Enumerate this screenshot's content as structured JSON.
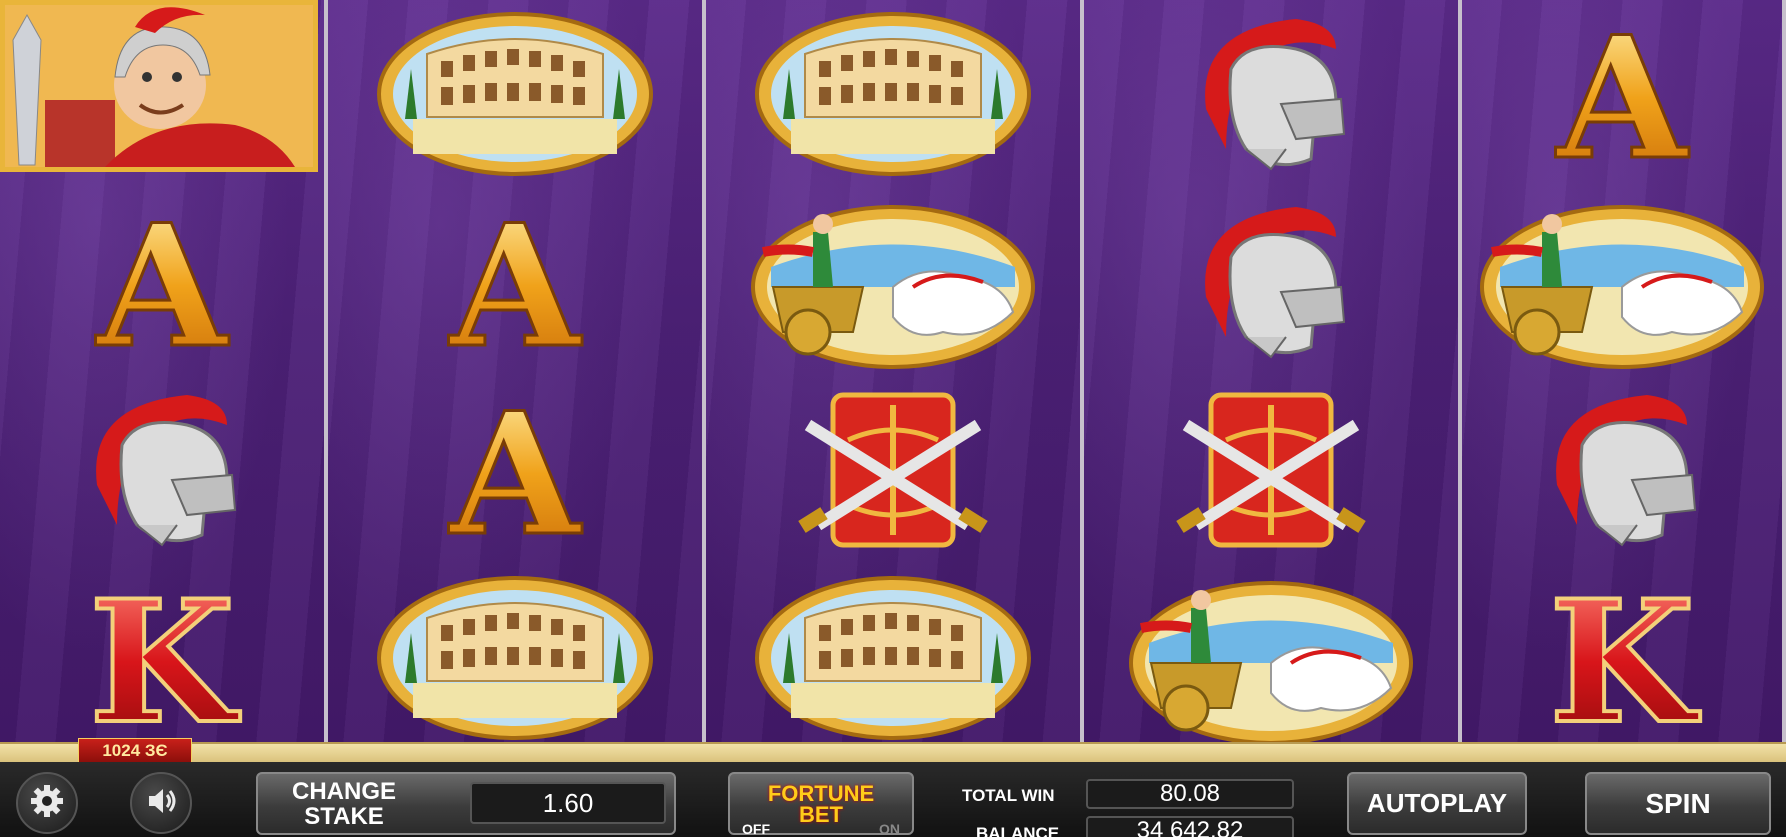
{
  "reels": [
    {
      "name": "reel-1",
      "symbols": [
        "presenter",
        "A",
        "helmet",
        "K"
      ]
    },
    {
      "name": "reel-2",
      "symbols": [
        "colosseum",
        "A",
        "A",
        "colosseum"
      ]
    },
    {
      "name": "reel-3",
      "symbols": [
        "colosseum",
        "chariot",
        "shield",
        "colosseum"
      ]
    },
    {
      "name": "reel-4",
      "symbols": [
        "helmet",
        "helmet",
        "shield",
        "chariot"
      ]
    },
    {
      "name": "reel-5",
      "symbols": [
        "A",
        "chariot",
        "helmet",
        "K"
      ]
    }
  ],
  "ways_badge": "1024 ЗЄ",
  "controls": {
    "settings_icon": "gear-icon",
    "sound_icon": "speaker-icon",
    "change_stake_line1": "CHANGE",
    "change_stake_line2": "STAKE",
    "stake_value": "1.60",
    "fortune_bet_line1": "FORTUNE",
    "fortune_bet_line2": "BET",
    "fortune_off": "OFF",
    "fortune_on": "ON",
    "total_win_label": "TOTAL WIN",
    "total_win_value": "80.08",
    "balance_label": "BALANCE",
    "balance_value": "34 642.82",
    "autoplay_label": "AUTOPLAY",
    "spin_label": "SPIN"
  },
  "colors": {
    "reel_bg": "#4d2178",
    "gold": "#e9b53a",
    "letter_a": "#f0a21a",
    "letter_k": "#d8151a",
    "plume_red": "#d61a1a"
  }
}
